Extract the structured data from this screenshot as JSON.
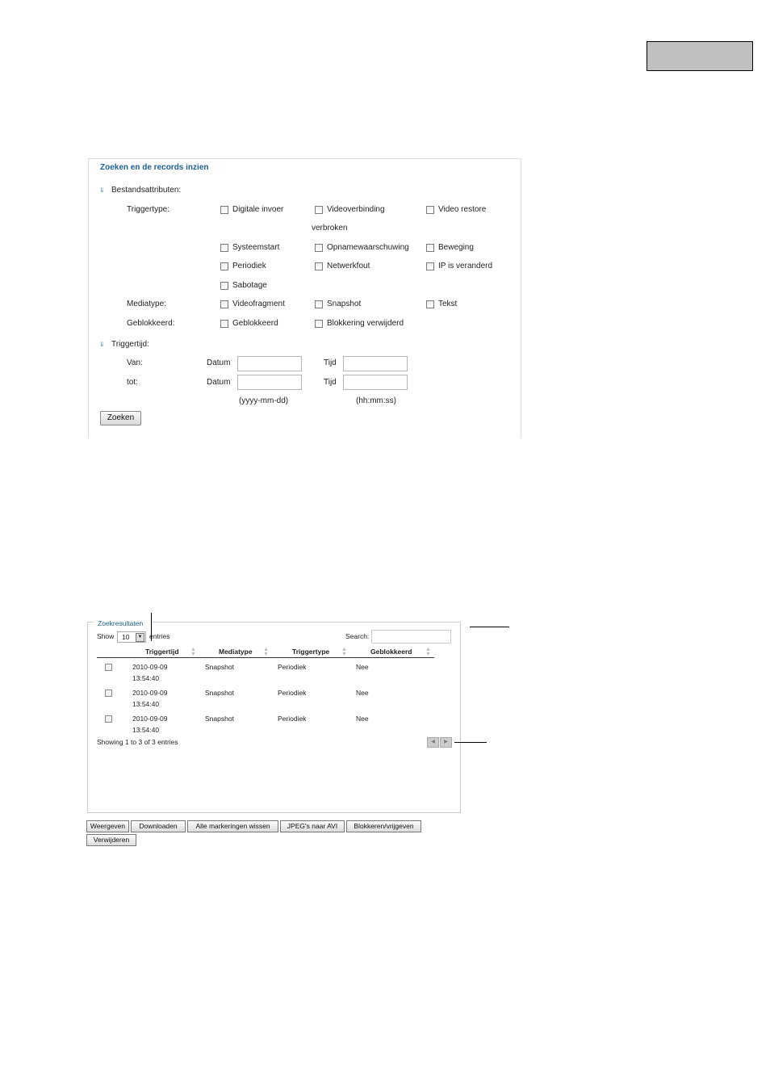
{
  "search": {
    "title": "Zoeken en de records inzien",
    "file_attributes": "Bestandsattributen:",
    "trigger_type_label": "Triggertype:",
    "trigger_options": {
      "digital_input": "Digitale invoer",
      "video_conn": "Videoverbinding",
      "video_conn_cont": "verbroken",
      "video_restore": "Video restore",
      "system_start": "Systeemstart",
      "record_warning": "Opnamewaarschuwing",
      "motion": "Beweging",
      "periodic": "Periodiek",
      "network_error": "Netwerkfout",
      "ip_changed": "IP is veranderd",
      "tamper": "Sabotage"
    },
    "media_type_label": "Mediatype:",
    "media_options": {
      "video": "Videofragment",
      "snapshot": "Snapshot",
      "text": "Tekst"
    },
    "locked_label": "Geblokkeerd:",
    "locked_options": {
      "locked": "Geblokkeerd",
      "unlocked": "Blokkering verwijderd"
    },
    "trigger_time": "Triggertijd:",
    "from": "Van:",
    "to": "tot:",
    "date": "Datum",
    "time": "Tijd",
    "date_format": "(yyyy-mm-dd)",
    "time_format": "(hh:mm:ss)",
    "search_button": "Zoeken"
  },
  "results": {
    "title": "Zoekresultaten",
    "show": "Show",
    "entries_value": "10",
    "entries": "entries",
    "search_label": "Search:",
    "columns": [
      "Triggertijd",
      "Mediatype",
      "Triggertype",
      "Geblokkeerd"
    ],
    "rows": [
      {
        "date": "2010-09-09",
        "time": "13:54:40",
        "media": "Snapshot",
        "trigger": "Periodiek",
        "locked": "Nee"
      },
      {
        "date": "2010-09-09",
        "time": "13:54:40",
        "media": "Snapshot",
        "trigger": "Periodiek",
        "locked": "Nee"
      },
      {
        "date": "2010-09-09",
        "time": "13:54:40",
        "media": "Snapshot",
        "trigger": "Periodiek",
        "locked": "Nee"
      }
    ],
    "showing": "Showing 1 to 3 of 3 entries"
  },
  "actions": {
    "view": "Weergeven",
    "download": "Downloaden",
    "clear_marks": "Alle markeringen wissen",
    "jpeg_avi": "JPEG's naar AVI",
    "lock_unlock": "Blokkeren/vrijgeven",
    "delete": "Verwijderen"
  },
  "icons": [
    "chevron-down-icon",
    "dropdown-arrow-icon",
    "sort-arrows-icon",
    "prev-page-icon",
    "next-page-icon"
  ]
}
